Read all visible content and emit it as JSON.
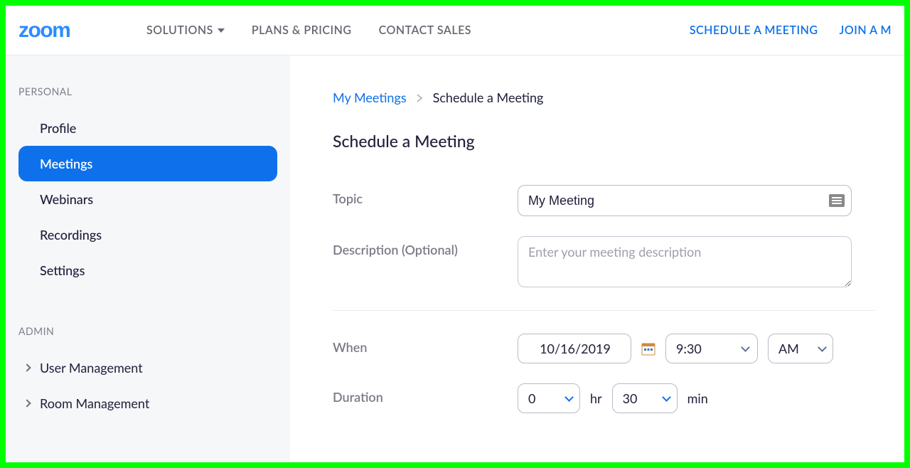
{
  "header": {
    "nav": [
      {
        "label": "SOLUTIONS",
        "has_caret": true
      },
      {
        "label": "PLANS & PRICING",
        "has_caret": false
      },
      {
        "label": "CONTACT SALES",
        "has_caret": false
      }
    ],
    "right_links": {
      "schedule": "SCHEDULE A MEETING",
      "join": "JOIN A M"
    }
  },
  "sidebar": {
    "personal_label": "PERSONAL",
    "personal_items": [
      {
        "label": "Profile",
        "active": false
      },
      {
        "label": "Meetings",
        "active": true
      },
      {
        "label": "Webinars",
        "active": false
      },
      {
        "label": "Recordings",
        "active": false
      },
      {
        "label": "Settings",
        "active": false
      }
    ],
    "admin_label": "ADMIN",
    "admin_items": [
      {
        "label": "User Management"
      },
      {
        "label": "Room Management"
      }
    ]
  },
  "main": {
    "breadcrumb": {
      "link": "My Meetings",
      "current": "Schedule a Meeting"
    },
    "title": "Schedule a Meeting",
    "form": {
      "topic_label": "Topic",
      "topic_value": "My Meeting",
      "description_label": "Description (Optional)",
      "description_placeholder": "Enter your meeting description",
      "when_label": "When",
      "when_date": "10/16/2019",
      "when_time": "9:30",
      "when_ampm": "AM",
      "duration_label": "Duration",
      "duration_hr_value": "0",
      "duration_hr_unit": "hr",
      "duration_min_value": "30",
      "duration_min_unit": "min"
    }
  }
}
